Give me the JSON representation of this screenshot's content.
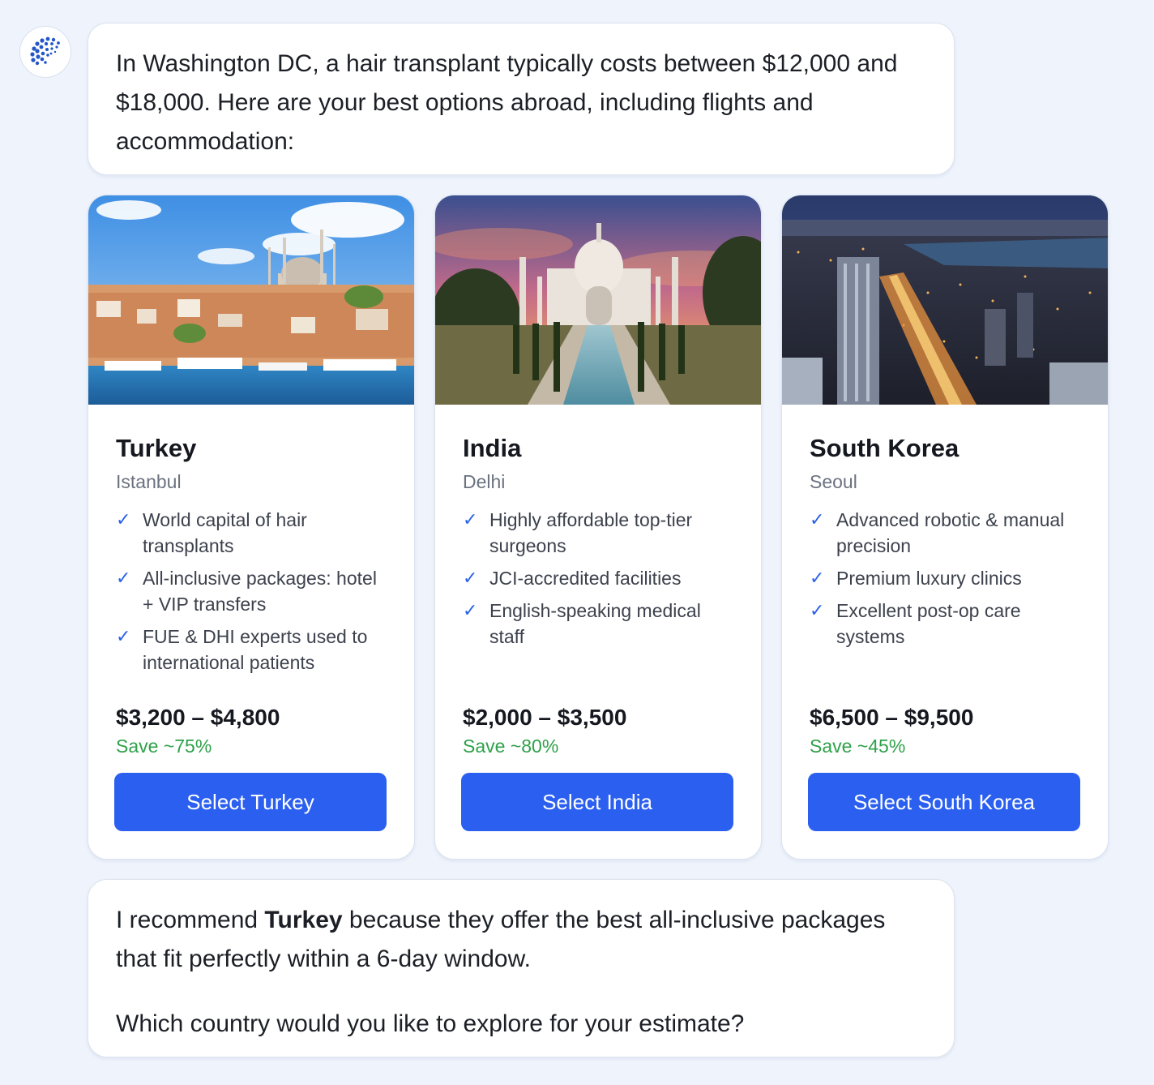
{
  "assistant": {
    "avatar_icon": "globe-logo-icon"
  },
  "intro_message": "In Washington DC, a hair transplant typically costs between $12,000 and $18,000. Here are your best options abroad, including flights and accommodation:",
  "colors": {
    "accent": "#2b5ff0",
    "check": "#2b62ea",
    "save": "#2fa14a",
    "background": "#eef3fc"
  },
  "options": [
    {
      "country": "Turkey",
      "city": "Istanbul",
      "image_alt": "Istanbul skyline with mosque and harbor",
      "features": [
        "World capital of hair transplants",
        "All-inclusive packages: hotel + VIP transfers",
        "FUE & DHI experts used to international patients"
      ],
      "price": "$3,200 – $4,800",
      "savings": "Save ~75%",
      "button_label": "Select Turkey"
    },
    {
      "country": "India",
      "city": "Delhi",
      "image_alt": "Taj Mahal at sunset",
      "features": [
        "Highly affordable top-tier surgeons",
        "JCI-accredited facilities",
        "English-speaking medical staff"
      ],
      "price": "$2,000 – $3,500",
      "savings": "Save ~80%",
      "button_label": "Select India"
    },
    {
      "country": "South Korea",
      "city": "Seoul",
      "image_alt": "Seoul city lights at night",
      "features": [
        "Advanced robotic & manual precision",
        "Premium luxury clinics",
        "Excellent post-op care systems"
      ],
      "price": "$6,500 – $9,500",
      "savings": "Save ~45%",
      "button_label": "Select South Korea"
    }
  ],
  "recommendation": {
    "prefix": "I recommend ",
    "highlight": "Turkey",
    "suffix": " because they offer the best all-inclusive packages that fit perfectly within a 6-day window.",
    "question": "Which country would you like to explore for your estimate?"
  }
}
